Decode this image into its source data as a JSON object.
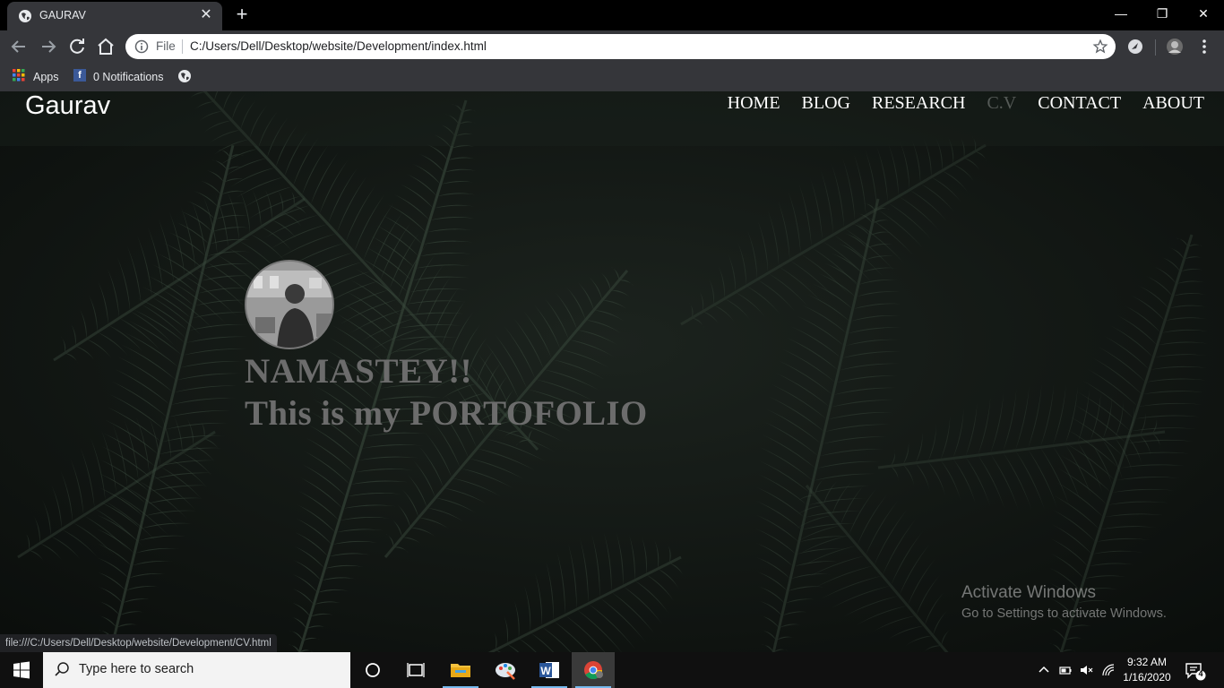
{
  "browser": {
    "tab_title": "GAURAV",
    "omnibox": {
      "scheme_label": "File",
      "url": "C:/Users/Dell/Desktop/website/Development/index.html"
    },
    "bookmarks": [
      {
        "label": "Apps"
      },
      {
        "label": "0 Notifications"
      }
    ],
    "status_url": "file:///C:/Users/Dell/Desktop/website/Development/CV.html"
  },
  "site": {
    "brand": "Gaurav",
    "nav": [
      {
        "label": "HOME",
        "active": false
      },
      {
        "label": "BLOG",
        "active": false
      },
      {
        "label": "RESEARCH",
        "active": false
      },
      {
        "label": "C.V",
        "active": true
      },
      {
        "label": "CONTACT",
        "active": false
      },
      {
        "label": "ABOUT",
        "active": false
      }
    ],
    "hero": {
      "line1": "NAMASTEY!!",
      "line2": "This is my PORTOFOLIO"
    }
  },
  "watermark": {
    "title": "Activate Windows",
    "subtitle": "Go to Settings to activate Windows."
  },
  "taskbar": {
    "search_placeholder": "Type here to search",
    "time": "9:32 AM",
    "date": "1/16/2020",
    "notification_count": "4"
  },
  "colors": {
    "chrome_bg": "#35363a",
    "page_bg": "#101511",
    "fern": "#3a4a3d",
    "hero_text": "#6c6c6c",
    "active_nav": "#555a57"
  }
}
